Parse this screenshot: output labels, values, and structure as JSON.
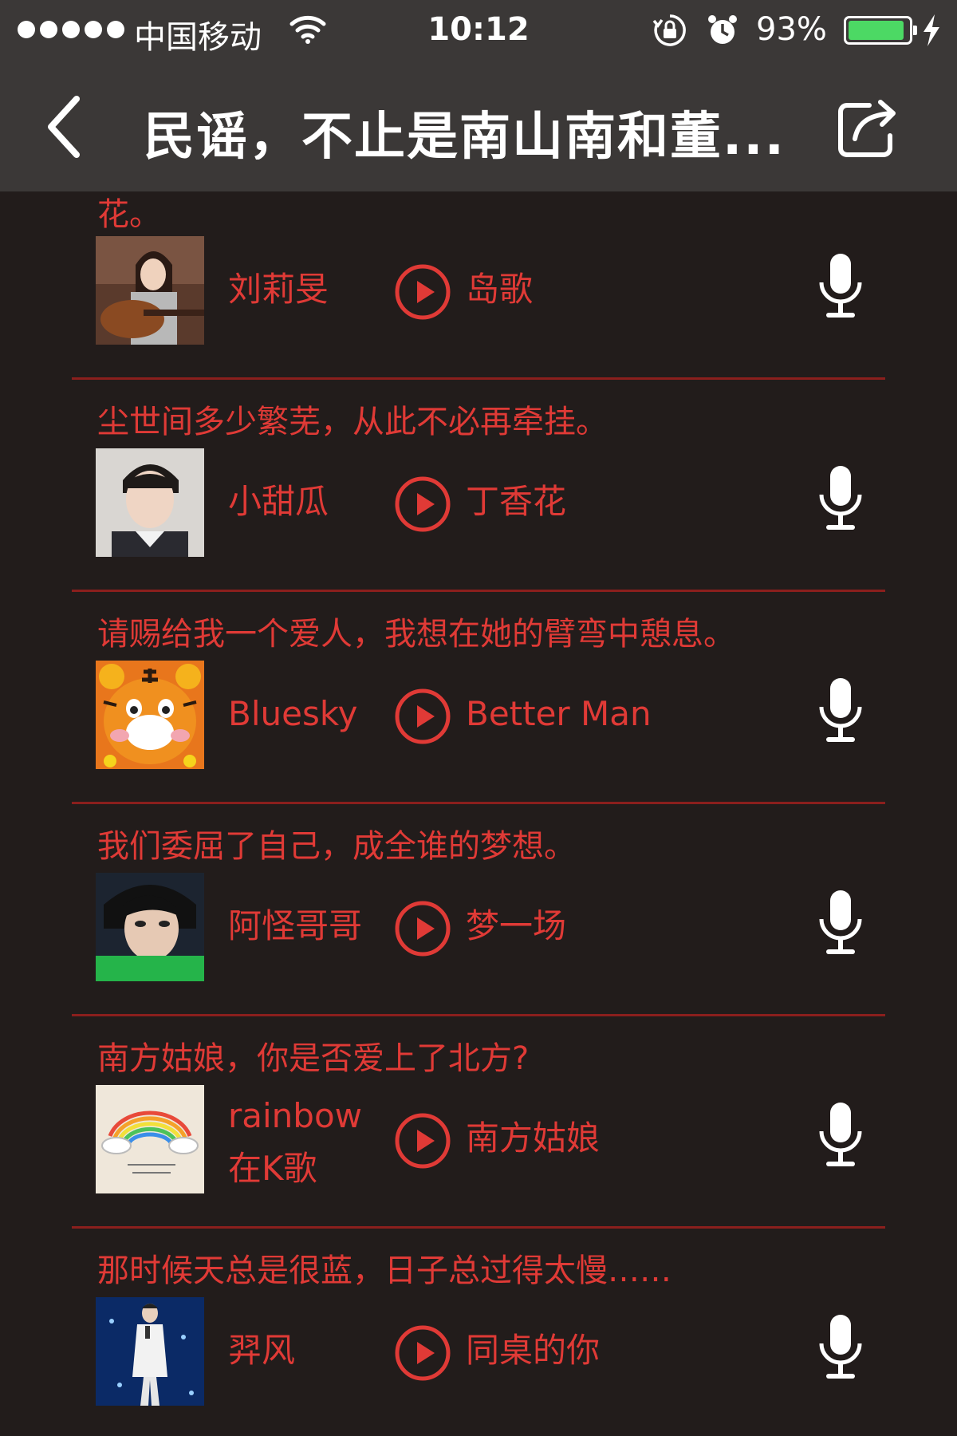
{
  "status": {
    "carrier": "中国移动",
    "time": "10:12",
    "battery_pct": "93%",
    "battery_level": 0.93,
    "battery_color": "#4cd964"
  },
  "nav": {
    "title": "民谣，不止是南山南和董...",
    "back_icon": "chevron-left-icon",
    "share_icon": "share-icon"
  },
  "accent_color": "#e03a36",
  "top_fragment": "花。",
  "items": [
    {
      "lyric": "",
      "user": "刘莉旻",
      "song": "岛歌"
    },
    {
      "lyric": "尘世间多少繁芜，从此不必再牵挂。",
      "user": "小甜瓜",
      "song": "丁香花"
    },
    {
      "lyric": "请赐给我一个爱人，我想在她的臂弯中憩息。",
      "user": "Bluesky",
      "song": "Better Man"
    },
    {
      "lyric": "我们委屈了自己，成全谁的梦想。",
      "user": "阿怪哥哥",
      "song": "梦一场"
    },
    {
      "lyric": "南方姑娘，你是否爱上了北方?",
      "user": "rainbow在K歌",
      "song": "南方姑娘"
    },
    {
      "lyric": "那时候天总是很蓝，日子总过得太慢……",
      "user": "羿风",
      "song": "同桌的你"
    }
  ]
}
